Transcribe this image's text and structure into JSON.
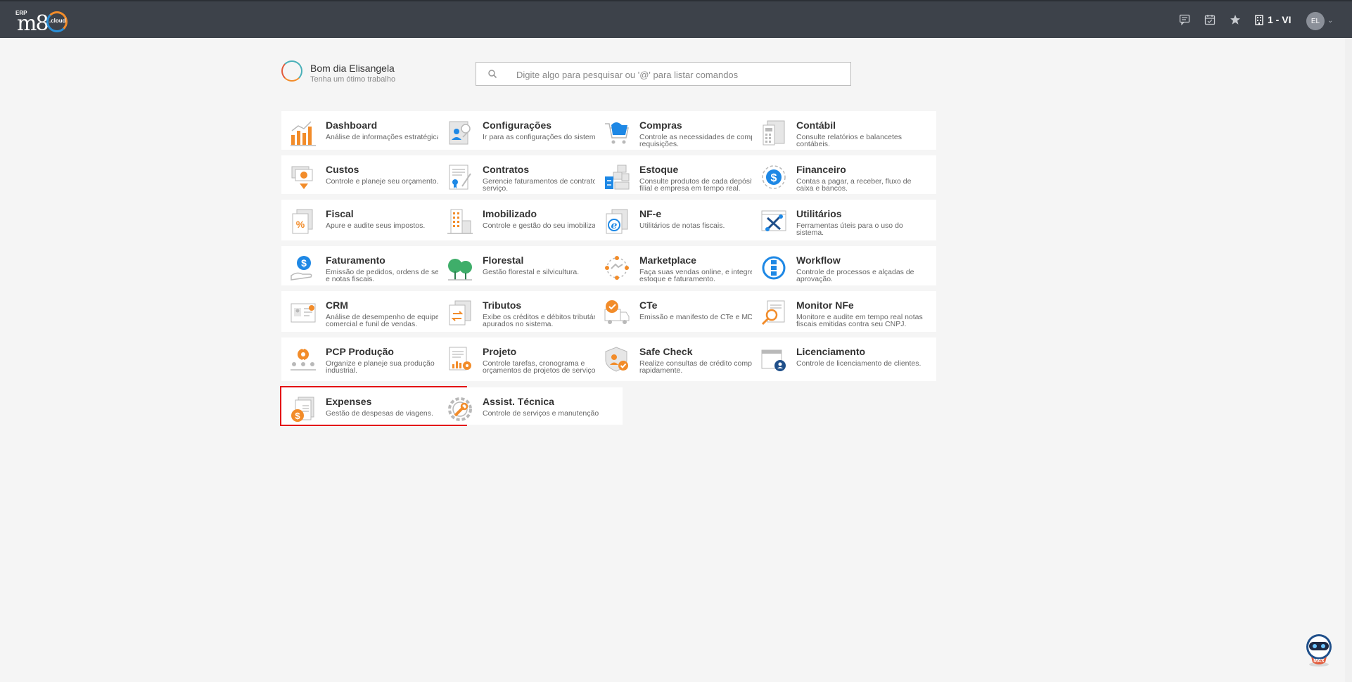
{
  "topbar": {
    "logo_erp": "ERP",
    "logo_main": "m8",
    "logo_cloud": ".cloud",
    "company": "1 - VI",
    "avatar_initials": "EL",
    "icons": [
      "chat-icon",
      "calendar-icon",
      "star-icon",
      "building-icon"
    ]
  },
  "greeting": {
    "title": "Bom dia Elisangela",
    "subtitle": "Tenha um ótimo trabalho"
  },
  "search": {
    "placeholder": "Digite algo para pesquisar ou '@' para listar comandos"
  },
  "modules": [
    {
      "title": "Dashboard",
      "desc": "Análise de informações estratégicas.",
      "icon": "dashboard-chart-icon"
    },
    {
      "title": "Configurações",
      "desc": "Ir para as configurações do sistema.",
      "icon": "settings-icon"
    },
    {
      "title": "Compras",
      "desc": "Controle as necessidades de compras e requisições.",
      "icon": "cart-icon"
    },
    {
      "title": "Contábil",
      "desc": "Consulte relatórios e balancetes contábeis.",
      "icon": "accounting-icon"
    },
    {
      "title": "Custos",
      "desc": "Controle e planeje seu orçamento.",
      "icon": "costs-icon"
    },
    {
      "title": "Contratos",
      "desc": "Gerencie faturamentos de contratos de serviço.",
      "icon": "contract-icon"
    },
    {
      "title": "Estoque",
      "desc": "Consulte produtos de cada depósito, filial e empresa em tempo real.",
      "icon": "inventory-icon"
    },
    {
      "title": "Financeiro",
      "desc": "Contas a pagar, a receber, fluxo de caixa e bancos.",
      "icon": "finance-icon"
    },
    {
      "title": "Fiscal",
      "desc": "Apure e audite seus impostos.",
      "icon": "tax-percent-icon"
    },
    {
      "title": "Imobilizado",
      "desc": "Controle e gestão do seu imobilizado.",
      "icon": "building-assets-icon"
    },
    {
      "title": "NF-e",
      "desc": "Utilitários de notas fiscais.",
      "icon": "nfe-icon"
    },
    {
      "title": "Utilitários",
      "desc": "Ferramentas úteis para o uso do sistema.",
      "icon": "tools-icon"
    },
    {
      "title": "Faturamento",
      "desc": "Emissão de pedidos, ordens de serviço e notas fiscais.",
      "icon": "billing-icon"
    },
    {
      "title": "Florestal",
      "desc": "Gestão florestal e silvicultura.",
      "icon": "forest-icon"
    },
    {
      "title": "Marketplace",
      "desc": "Faça suas vendas online, e integre ao estoque e faturamento.",
      "icon": "marketplace-icon"
    },
    {
      "title": "Workflow",
      "desc": "Controle de processos e alçadas de aprovação.",
      "icon": "workflow-icon"
    },
    {
      "title": "CRM",
      "desc": "Análise de desempenho de equipe comercial e funil de vendas.",
      "icon": "crm-icon"
    },
    {
      "title": "Tributos",
      "desc": "Exibe os créditos e débitos tributários apurados no sistema.",
      "icon": "tributes-icon"
    },
    {
      "title": "CTe",
      "desc": "Emissão e manifesto de CTe e MDFe.",
      "icon": "truck-icon"
    },
    {
      "title": "Monitor NFe",
      "desc": "Monitore e audite em tempo real notas fiscais emitidas contra seu CNPJ.",
      "icon": "monitor-search-icon"
    },
    {
      "title": "PCP Produção",
      "desc": "Organize e planeje sua produção industrial.",
      "icon": "production-icon"
    },
    {
      "title": "Projeto",
      "desc": "Controle tarefas, cronograma e orçamentos de projetos de serviços.",
      "icon": "project-icon"
    },
    {
      "title": "Safe Check",
      "desc": "Realize consultas de crédito completas rapidamente.",
      "icon": "shield-check-icon"
    },
    {
      "title": "Licenciamento",
      "desc": "Controle de licenciamento de clientes.",
      "icon": "license-icon"
    },
    {
      "title": "Expenses",
      "desc": "Gestão de despesas de viagens.",
      "icon": "expenses-icon"
    },
    {
      "title": "Assist. Técnica",
      "desc": "Controle de serviços e manutenção",
      "icon": "wrench-gear-icon"
    }
  ],
  "assistant": {
    "label": "MAX"
  },
  "colors": {
    "topbar": "#3d424a",
    "accent_orange": "#f28c2a",
    "accent_blue": "#1e88e5",
    "selection": "#e30613"
  }
}
